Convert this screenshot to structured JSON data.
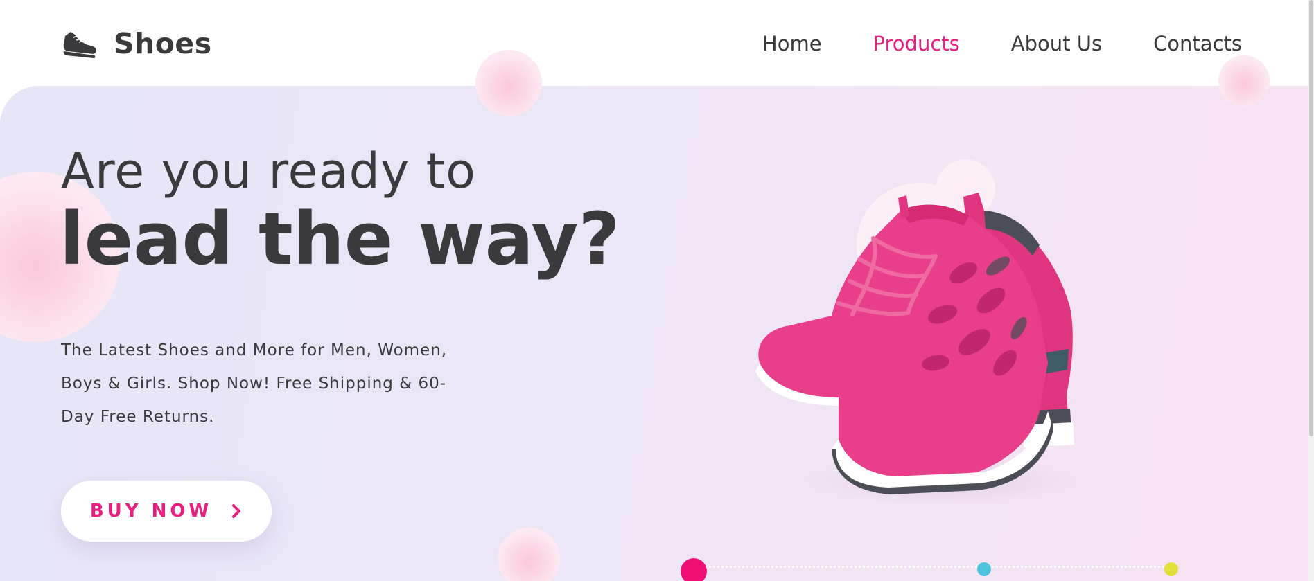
{
  "brand": {
    "name": "Shoes",
    "icon": "sneaker-icon"
  },
  "nav": {
    "items": [
      {
        "label": "Home",
        "active": false
      },
      {
        "label": "Products",
        "active": true
      },
      {
        "label": "About Us",
        "active": false
      },
      {
        "label": "Contacts",
        "active": false
      }
    ]
  },
  "hero": {
    "line1": "Are you ready to",
    "line2": "lead the way?",
    "description": "The Latest Shoes and More for Men, Women, Boys & Girls. Shop Now! Free Shipping & 60-Day Free Returns.",
    "cta_label": "BUY NOW",
    "cta_icon": "chevron-right-icon",
    "product_image": "pink-sneakers-image"
  },
  "slider": {
    "dots": [
      {
        "color": "#ef0f75",
        "active": true
      },
      {
        "color": "#4fc3dc",
        "active": false
      },
      {
        "color": "#e3df3a",
        "active": false
      }
    ]
  },
  "colors": {
    "accent": "#e91e7e",
    "text": "#3a3a3c"
  }
}
